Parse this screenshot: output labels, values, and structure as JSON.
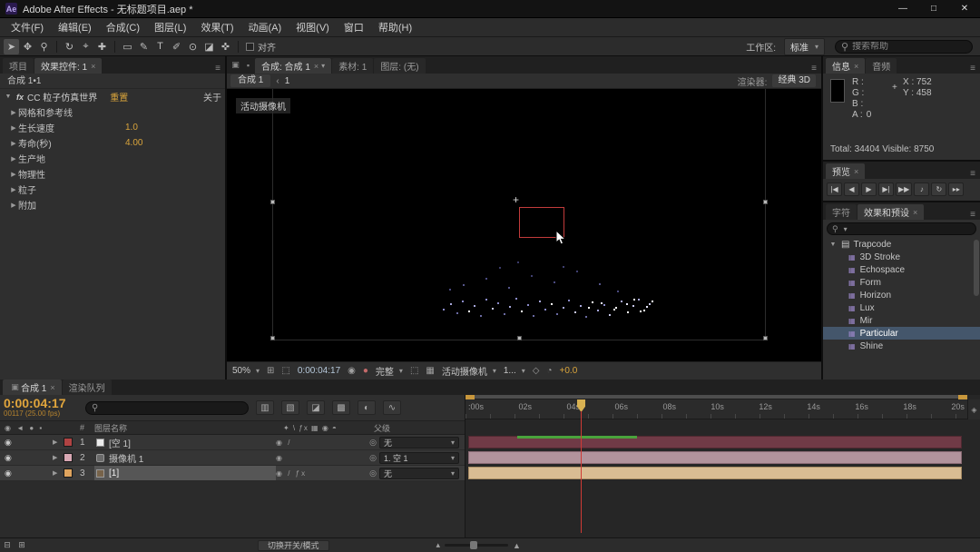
{
  "colors": {
    "accent_orange": "#d9a43b",
    "selection_blue": "#44566b",
    "layer1_swatch": "#b04343",
    "layer2_swatch": "#d9a8b4",
    "layer3_swatch": "#dfa45e",
    "layer1_bar": "#703a46",
    "layer2_bar": "#b2939c",
    "layer3_bar": "#d9bc93",
    "work_area_handle": "#c8973c",
    "playhead_red": "#cf3a35",
    "selection_box_red": "#c23b3b",
    "green_segment": "#49a33c"
  },
  "icons": {
    "search": "⚲",
    "menu": "≡",
    "dropdown": "▾",
    "close": "×",
    "twirl_open": "▼",
    "twirl_closed": "▶",
    "panel": "▣",
    "lock": "▪",
    "eye": "◉",
    "pickwhip": "◎",
    "crosshair": "+",
    "grid": "⊞",
    "region": "⬚",
    "checker": "▦",
    "snapshot": "◉",
    "channels": "●",
    "pixel_aspect": "◇",
    "fast_preview": "◔",
    "folder": "▤",
    "effect": "▦",
    "nav_arrow": "‹",
    "marker": "◈",
    "mountain_small": "▴",
    "mountain_big": "▲",
    "expand": "⊟",
    "transfer": "⊞"
  },
  "window": {
    "app_initials": "Ae",
    "title": "Adobe After Effects - 无标题项目.aep *",
    "controls": {
      "minimize": "—",
      "maximize": "□",
      "close": "✕"
    }
  },
  "menu": {
    "items": [
      "文件(F)",
      "编辑(E)",
      "合成(C)",
      "图层(L)",
      "效果(T)",
      "动画(A)",
      "视图(V)",
      "窗口",
      "帮助(H)"
    ]
  },
  "toolbar": {
    "tools": [
      {
        "name": "selection-tool",
        "glyph": "➤"
      },
      {
        "name": "hand-tool",
        "glyph": "✥"
      },
      {
        "name": "zoom-tool",
        "glyph": "⚲"
      },
      {
        "name": "rotation-tool",
        "glyph": "↻"
      },
      {
        "name": "camera-tool",
        "glyph": "⌖"
      },
      {
        "name": "pan-behind-tool",
        "glyph": "✚"
      },
      {
        "name": "shape-tool",
        "glyph": "▭"
      },
      {
        "name": "pen-tool",
        "glyph": "✎"
      },
      {
        "name": "type-tool",
        "glyph": "T"
      },
      {
        "name": "brush-tool",
        "glyph": "✐"
      },
      {
        "name": "clone-stamp-tool",
        "glyph": "⊙"
      },
      {
        "name": "eraser-tool",
        "glyph": "◪"
      },
      {
        "name": "puppet-pin-tool",
        "glyph": "✜"
      }
    ],
    "align_label": "对齐",
    "workspace_label": "工作区:",
    "workspace_value": "标准",
    "search_placeholder": "搜索帮助"
  },
  "effect_controls": {
    "tabs": [
      {
        "label": "项目"
      },
      {
        "label": "效果控件: 1"
      }
    ],
    "comp_ref": "合成 1•1",
    "effect": {
      "fx_badge": "fx",
      "name": "CC 粒子仿真世界",
      "reset": "重置",
      "about": "关于"
    },
    "properties": [
      {
        "label": "网格和参考线",
        "value": ""
      },
      {
        "label": "生长速度",
        "value": "1.0"
      },
      {
        "label": "寿命(秒)",
        "value": "4.00"
      },
      {
        "label": "生产地",
        "value": ""
      },
      {
        "label": "物理性",
        "value": ""
      },
      {
        "label": "粒子",
        "value": ""
      },
      {
        "label": "附加",
        "value": ""
      }
    ]
  },
  "comp_panel": {
    "tabs": [
      {
        "label": "合成: 合成 1"
      },
      {
        "label": "素材: 1"
      },
      {
        "label": "图层: (无)"
      }
    ],
    "nav_tab": "合成 1",
    "nav_page": "1",
    "renderer_label": "渲染器:",
    "renderer_value": "经典 3D",
    "camera_overlay": "活动摄像机",
    "bottom": {
      "zoom": "50%",
      "timecode": "0:00:04:17",
      "resolution": "完整",
      "camera": "活动摄像机",
      "views": "1...",
      "exposure": "+0.0"
    }
  },
  "info_panel": {
    "tabs": [
      {
        "label": "信息"
      },
      {
        "label": "音频"
      }
    ],
    "channels": [
      {
        "label": "R :",
        "value": ""
      },
      {
        "label": "G :",
        "value": ""
      },
      {
        "label": "B :",
        "value": ""
      },
      {
        "label": "A :",
        "value": "0"
      }
    ],
    "x": "X : 752",
    "y": "Y : 458",
    "totals": "Total: 34404  Visible: 8750"
  },
  "preview_panel": {
    "tab": "预览",
    "buttons": [
      {
        "name": "first-frame-button",
        "glyph": "|◀"
      },
      {
        "name": "previous-frame-button",
        "glyph": "◀"
      },
      {
        "name": "play-button",
        "glyph": "▶"
      },
      {
        "name": "next-frame-button",
        "glyph": "▶|"
      },
      {
        "name": "last-frame-button",
        "glyph": "▶▶"
      },
      {
        "name": "audio-toggle-button",
        "glyph": "♪"
      },
      {
        "name": "loop-button",
        "glyph": "↻"
      },
      {
        "name": "ram-preview-button",
        "glyph": "▸▸"
      }
    ]
  },
  "effects_presets": {
    "tabs": [
      {
        "label": "字符"
      },
      {
        "label": "效果和预设"
      }
    ],
    "folder": "Trapcode",
    "items": [
      {
        "label": "3D Stroke"
      },
      {
        "label": "Echospace"
      },
      {
        "label": "Form"
      },
      {
        "label": "Horizon"
      },
      {
        "label": "Lux"
      },
      {
        "label": "Mir"
      },
      {
        "label": "Particular",
        "selected": true
      },
      {
        "label": "Shine"
      }
    ]
  },
  "timeline": {
    "tabs": [
      {
        "label": "合成 1"
      },
      {
        "label": "渲染队列"
      }
    ],
    "timecode": "0:00:04:17",
    "frame_info": "00117 (25.00 fps)",
    "toggles": [
      {
        "name": "composition-flowchart-icon",
        "glyph": "▥"
      },
      {
        "name": "draft-3d-icon",
        "glyph": "▧"
      },
      {
        "name": "shy-icon",
        "glyph": "◪"
      },
      {
        "name": "frame-blend-icon",
        "glyph": "▩"
      },
      {
        "name": "motion-blur-icon",
        "glyph": "◐"
      },
      {
        "name": "graph-editor-icon",
        "glyph": "∿"
      }
    ],
    "columns": {
      "av": "◉ ◄ ● ▪",
      "hash": "#",
      "layer_name": "图层名称",
      "switches": "✦ \\ ƒx ▦ ◉ ◓",
      "parent": "父级"
    },
    "layers": [
      {
        "index": "1",
        "name": "[空 1]",
        "switches": "◉ /",
        "parent": "无"
      },
      {
        "index": "2",
        "name": "摄像机 1",
        "switches": "◉",
        "parent": "1. 空 1"
      },
      {
        "index": "3",
        "name": "[1]",
        "switches": "◉ / ƒx",
        "parent": "无"
      }
    ],
    "ruler_ticks": [
      ":00s",
      "02s",
      "04s",
      "06s",
      "08s",
      "10s",
      "12s",
      "14s",
      "16s",
      "18s",
      "20s"
    ]
  },
  "status_bar": {
    "label": "切换开关/模式"
  }
}
